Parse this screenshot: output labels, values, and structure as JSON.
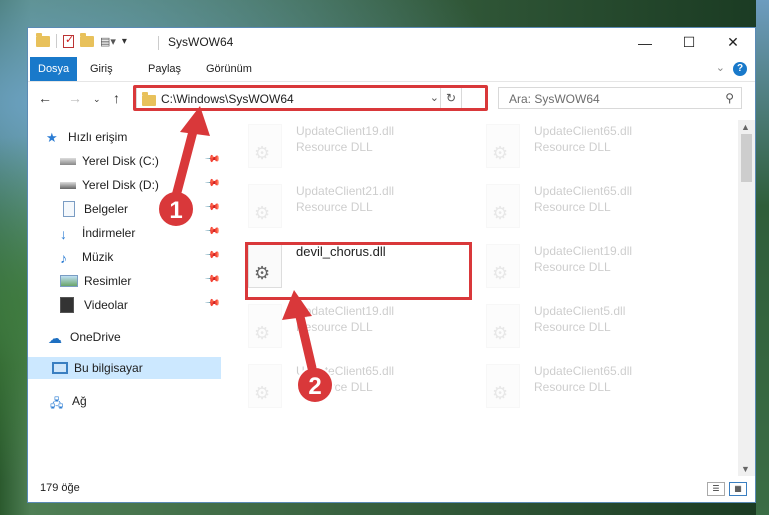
{
  "window": {
    "title": "SysWOW64"
  },
  "ribbon": {
    "tabs": [
      "Dosya",
      "Giriş",
      "Paylaş",
      "Görünüm"
    ]
  },
  "address": {
    "path": "C:\\Windows\\SysWOW64"
  },
  "search": {
    "placeholder": "Ara: SysWOW64"
  },
  "sidebar": {
    "quick_access": "Hızlı erişim",
    "items": [
      "Yerel Disk (C:)",
      "Yerel Disk (D:)",
      "Belgeler",
      "İndirmeler",
      "Müzik",
      "Resimler",
      "Videolar"
    ],
    "onedrive": "OneDrive",
    "this_pc": "Bu bilgisayar",
    "network": "Ağ"
  },
  "files": [
    {
      "name": "UpdateClient19.dll",
      "type": "Resource DLL"
    },
    {
      "name": "UpdateClient65.dll",
      "type": "Resource DLL"
    },
    {
      "name": "UpdateClient21.dll",
      "type": "Resource DLL"
    },
    {
      "name": "UpdateClient65.dll",
      "type": "Resource DLL"
    },
    {
      "name": "devil_chorus.dll",
      "type": ""
    },
    {
      "name": "UpdateClient19.dll",
      "type": "Resource DLL"
    },
    {
      "name": "UpdateClient19.dll",
      "type": "Resource DLL"
    },
    {
      "name": "UpdateClient5.dll",
      "type": "Resource DLL"
    },
    {
      "name": "UpdateClient65.dll",
      "type": "Resource DLL"
    },
    {
      "name": "UpdateClient65.dll",
      "type": "Resource DLL"
    }
  ],
  "status": {
    "count": "179 öğe"
  },
  "callouts": [
    "1",
    "2"
  ],
  "colors": {
    "accent": "#1979ca",
    "highlight": "#d9383a"
  }
}
